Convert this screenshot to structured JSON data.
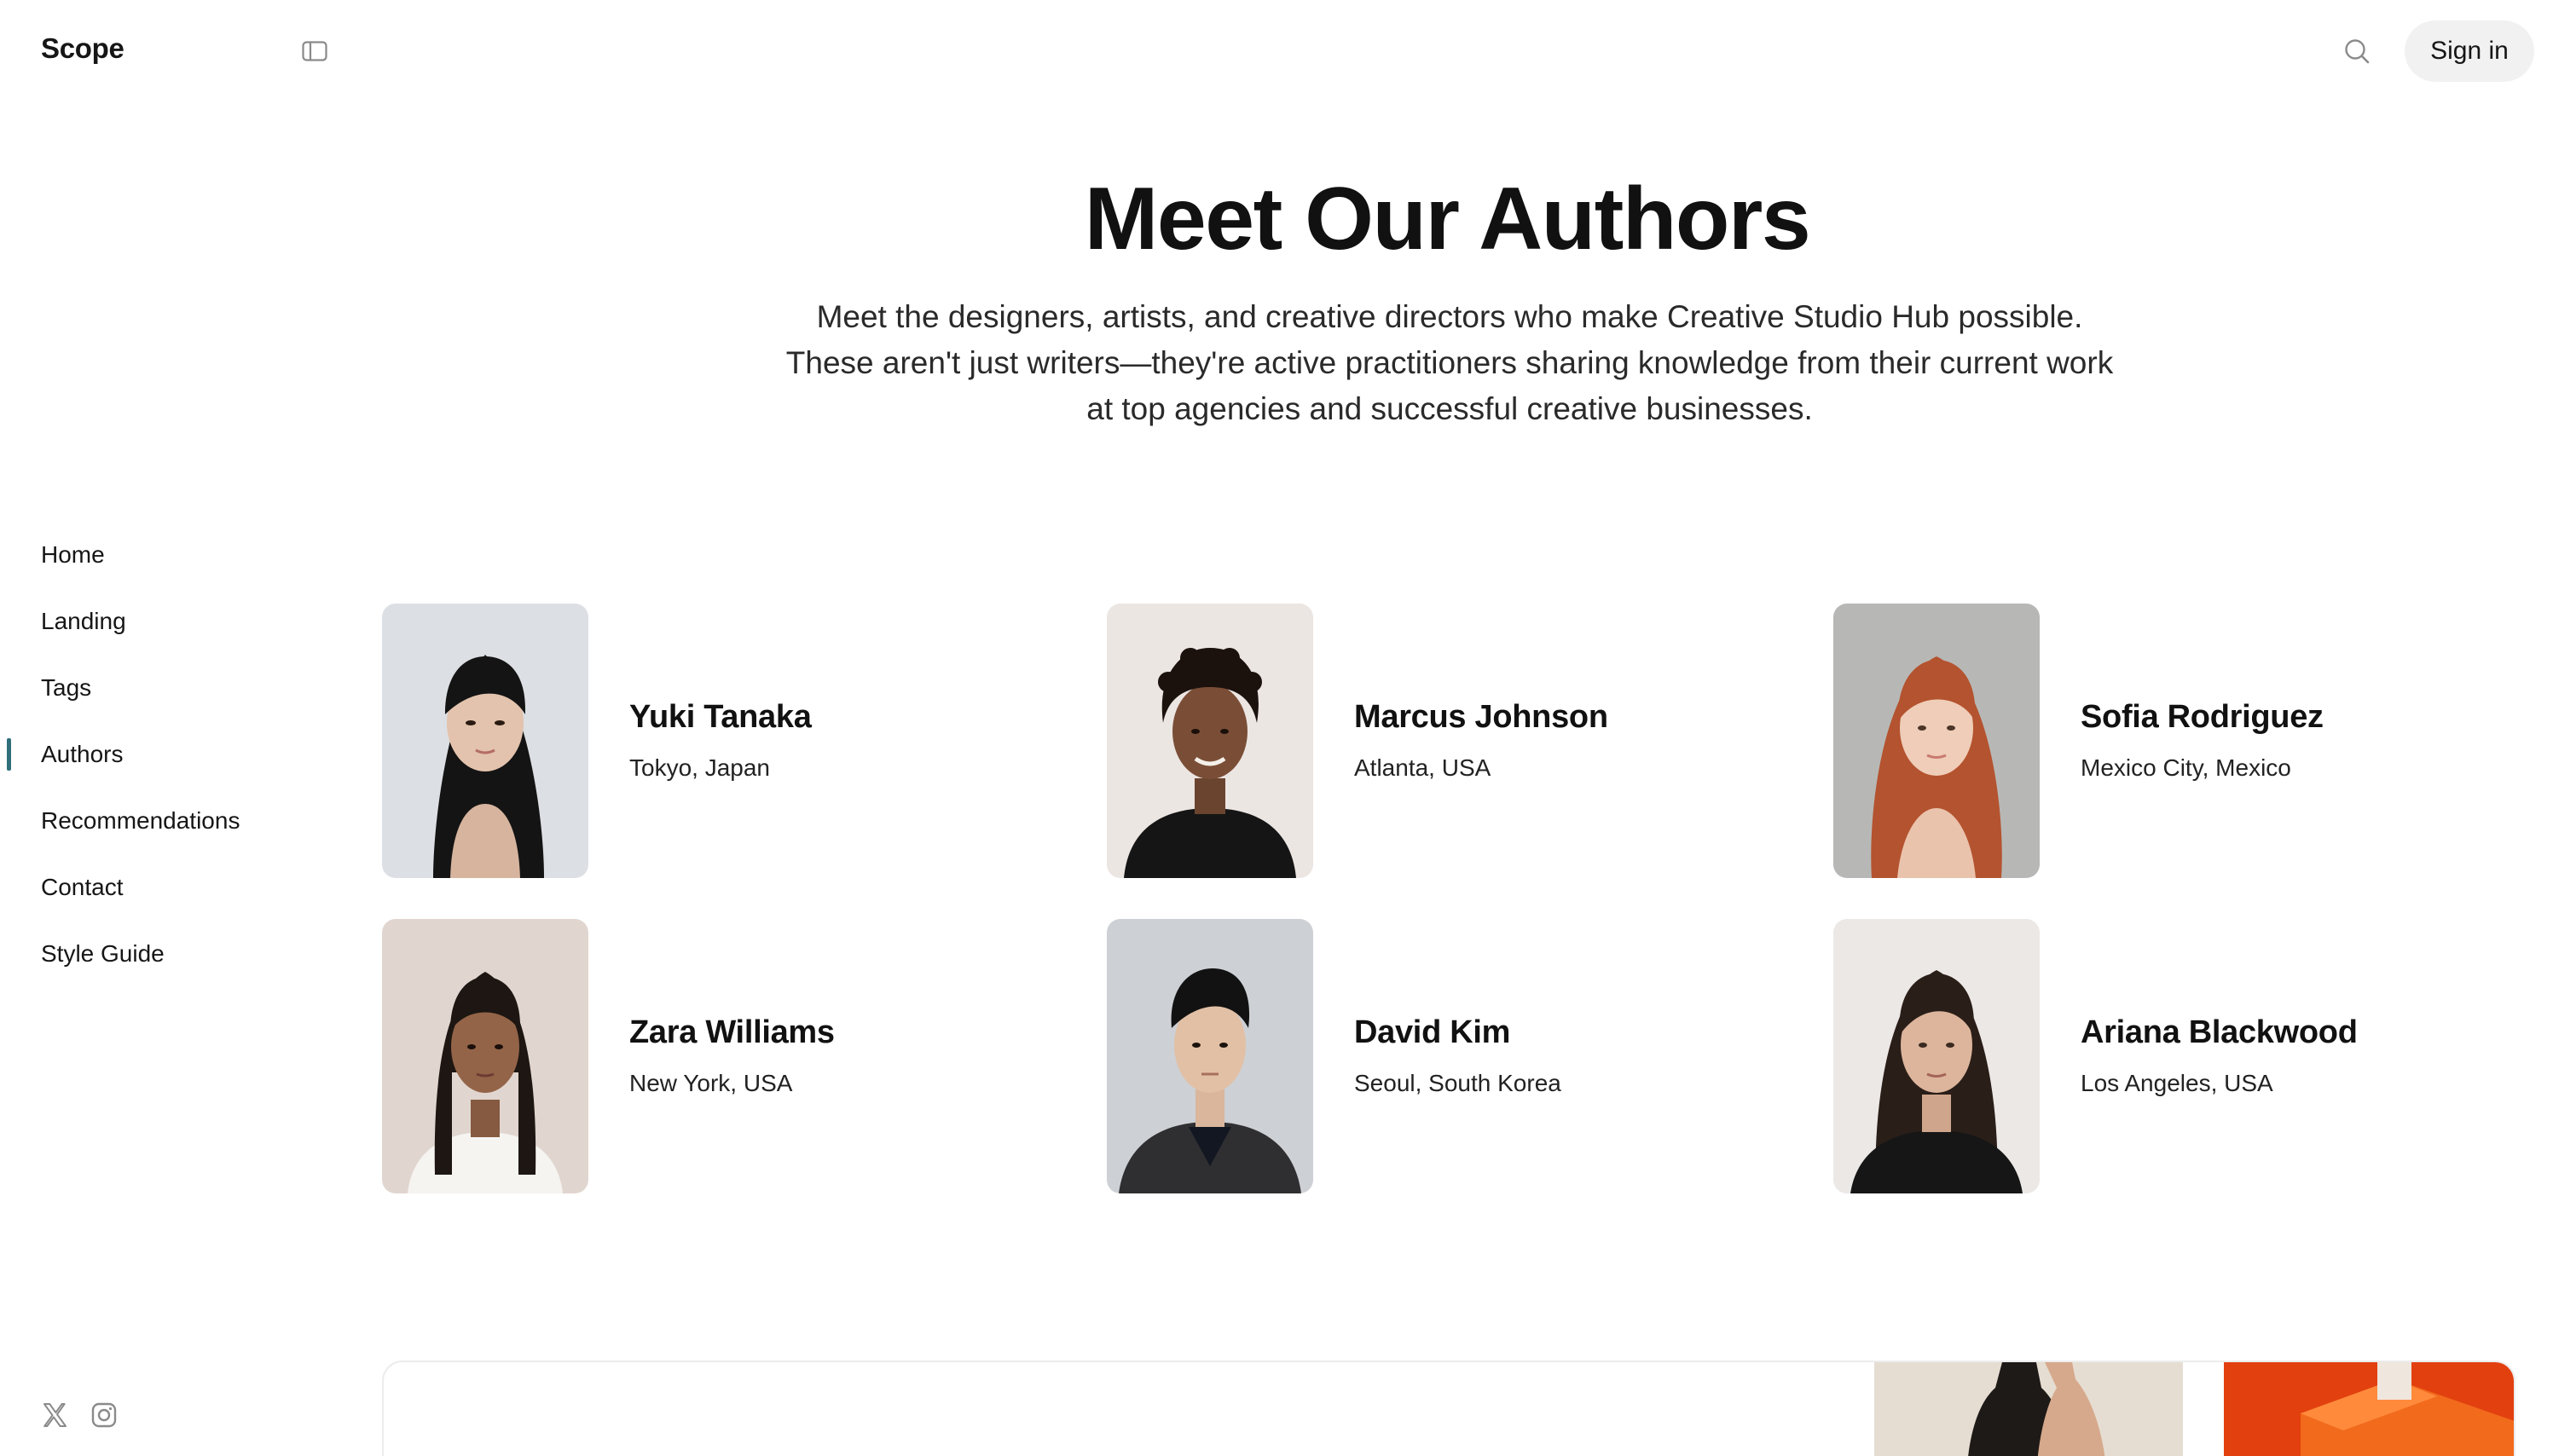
{
  "header": {
    "brand": "Scope",
    "sidebar_toggle_icon": "sidebar-panel-icon",
    "search_icon": "search-icon",
    "signin_label": "Sign in"
  },
  "nav": {
    "items": [
      {
        "label": "Home",
        "active": false
      },
      {
        "label": "Landing",
        "active": false
      },
      {
        "label": "Tags",
        "active": false
      },
      {
        "label": "Authors",
        "active": true
      },
      {
        "label": "Recommendations",
        "active": false
      },
      {
        "label": "Contact",
        "active": false
      },
      {
        "label": "Style Guide",
        "active": false
      }
    ],
    "active_indicator_color": "#2f6f7a"
  },
  "socials": [
    {
      "icon": "x-twitter-icon"
    },
    {
      "icon": "instagram-icon"
    }
  ],
  "hero": {
    "title": "Meet Our Authors",
    "subtitle_lines": [
      "Meet the designers, artists, and creative directors who make Creative Studio Hub possible.",
      "These aren't just writers—they're active practitioners sharing knowledge from their current work",
      "at top agencies and successful creative businesses."
    ]
  },
  "authors": [
    {
      "name": "Yuki Tanaka",
      "location": "Tokyo, Japan"
    },
    {
      "name": "Marcus Johnson",
      "location": "Atlanta, USA"
    },
    {
      "name": "Sofia Rodriguez",
      "location": "Mexico City, Mexico"
    },
    {
      "name": "Zara Williams",
      "location": "New York, USA"
    },
    {
      "name": "David Kim",
      "location": "Seoul, South Korea"
    },
    {
      "name": "Ariana Blackwood",
      "location": "Los Angeles, USA"
    }
  ]
}
